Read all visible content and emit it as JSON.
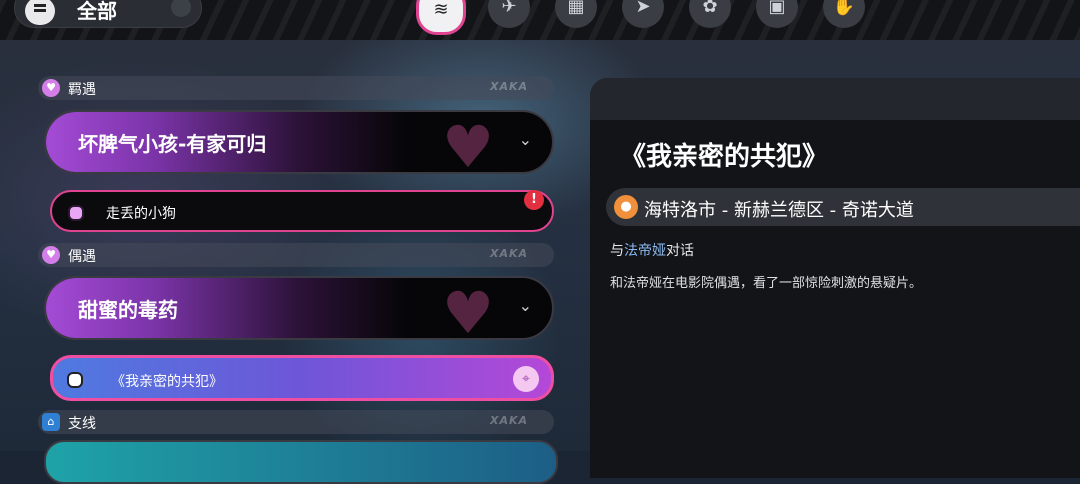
{
  "top": {
    "filter_label": "全部",
    "tabs": [
      {
        "icon": "stack-icon",
        "glyph": "≋",
        "active": true
      },
      {
        "icon": "main-story-icon",
        "glyph": "✈",
        "active": false
      },
      {
        "icon": "film-icon",
        "glyph": "▦",
        "active": false
      },
      {
        "icon": "paper-plane-icon",
        "glyph": "➤",
        "active": false
      },
      {
        "icon": "gift-icon",
        "glyph": "✿",
        "active": false
      },
      {
        "icon": "tv-icon",
        "glyph": "▣",
        "active": false
      },
      {
        "icon": "hand-icon",
        "glyph": "✋",
        "active": false
      }
    ]
  },
  "sections": [
    {
      "label": "羁遇",
      "deco": "XAKA",
      "quest_title": "坏脾气小孩-有家可归",
      "task": "走丢的小狗",
      "alert": "!"
    },
    {
      "label": "偶遇",
      "deco": "XAKA",
      "quest_title": "甜蜜的毒药",
      "task": "《我亲密的共犯》"
    },
    {
      "label": "支线",
      "deco": "XAKA"
    }
  ],
  "detail": {
    "title": "《我亲密的共犯》",
    "location": "海特洛市 - 新赫兰德区 - 奇诺大道",
    "objective_prefix": "与",
    "objective_name": "法帝娅",
    "objective_suffix": "对话",
    "description": "和法帝娅在电影院偶遇，看了一部惊险刺激的悬疑片。"
  },
  "colors": {
    "accent_pink": "#e0438f",
    "quest_purple": "#a44bd6",
    "location_orange": "#f0903a"
  }
}
